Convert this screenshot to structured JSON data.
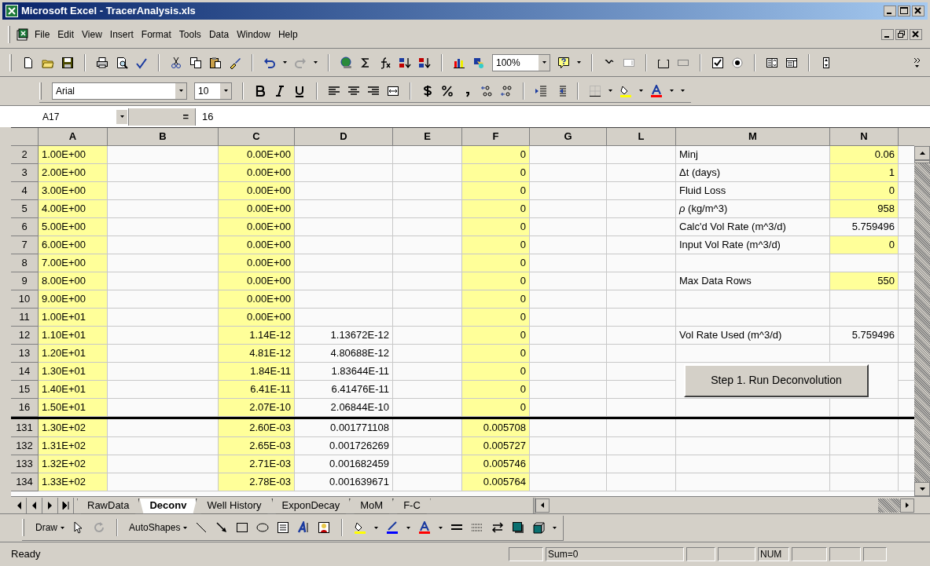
{
  "window": {
    "title": "Microsoft Excel - TracerAnalysis.xls"
  },
  "menu": [
    "File",
    "Edit",
    "View",
    "Insert",
    "Format",
    "Tools",
    "Data",
    "Window",
    "Help"
  ],
  "standard_toolbar": {
    "zoom": "100%"
  },
  "formatting_toolbar": {
    "font": "Arial",
    "size": "10"
  },
  "formula_bar": {
    "name_box": "A17",
    "equals": "=",
    "value": "16"
  },
  "sheet": {
    "columns": [
      {
        "label": "A"
      },
      {
        "label": "B"
      },
      {
        "label": "C"
      },
      {
        "label": "D"
      },
      {
        "label": "E"
      },
      {
        "label": "F"
      },
      {
        "label": "G"
      },
      {
        "label": "L"
      },
      {
        "label": "M"
      },
      {
        "label": "N"
      }
    ],
    "rows_top": [
      {
        "header": "2",
        "cells": [
          "1.00E+00",
          null,
          "0.00E+00",
          null,
          null,
          "0",
          null,
          null,
          "Minj",
          "0.06"
        ],
        "highlighted": [
          true,
          false,
          true,
          false,
          false,
          true,
          false,
          false,
          false,
          true
        ]
      },
      {
        "header": "3",
        "cells": [
          "2.00E+00",
          null,
          "0.00E+00",
          null,
          null,
          "0",
          null,
          null,
          "Δt (days)",
          "1"
        ],
        "highlighted": [
          true,
          false,
          true,
          false,
          false,
          true,
          false,
          false,
          false,
          true
        ]
      },
      {
        "header": "4",
        "cells": [
          "3.00E+00",
          null,
          "0.00E+00",
          null,
          null,
          "0",
          null,
          null,
          "Fluid Loss",
          "0"
        ],
        "highlighted": [
          true,
          false,
          true,
          false,
          false,
          true,
          false,
          false,
          false,
          true
        ]
      },
      {
        "header": "5",
        "cells": [
          "4.00E+00",
          null,
          "0.00E+00",
          null,
          null,
          "0",
          null,
          null,
          "*ρ* (kg/m^3)",
          "958"
        ],
        "highlighted": [
          true,
          false,
          true,
          false,
          false,
          true,
          false,
          false,
          false,
          true
        ]
      },
      {
        "header": "6",
        "cells": [
          "5.00E+00",
          null,
          "0.00E+00",
          null,
          null,
          "0",
          null,
          null,
          "Calc'd Vol Rate (m^3/d)",
          "5.759496"
        ],
        "highlighted": [
          true,
          false,
          true,
          false,
          false,
          true,
          false,
          false,
          false,
          false
        ]
      },
      {
        "header": "7",
        "cells": [
          "6.00E+00",
          null,
          "0.00E+00",
          null,
          null,
          "0",
          null,
          null,
          "Input Vol Rate (m^3/d)",
          "0"
        ],
        "highlighted": [
          true,
          false,
          true,
          false,
          false,
          true,
          false,
          false,
          false,
          true
        ]
      },
      {
        "header": "8",
        "cells": [
          "7.00E+00",
          null,
          "0.00E+00",
          null,
          null,
          "0",
          null,
          null,
          null,
          null
        ],
        "highlighted": [
          true,
          false,
          true,
          false,
          false,
          true,
          false,
          false,
          false,
          false
        ]
      },
      {
        "header": "9",
        "cells": [
          "8.00E+00",
          null,
          "0.00E+00",
          null,
          null,
          "0",
          null,
          null,
          "Max Data Rows",
          "550"
        ],
        "highlighted": [
          true,
          false,
          true,
          false,
          false,
          true,
          false,
          false,
          false,
          true
        ]
      },
      {
        "header": "10",
        "cells": [
          "9.00E+00",
          null,
          "0.00E+00",
          null,
          null,
          "0",
          null,
          null,
          null,
          null
        ],
        "highlighted": [
          true,
          false,
          true,
          false,
          false,
          true,
          false,
          false,
          false,
          false
        ]
      },
      {
        "header": "11",
        "cells": [
          "1.00E+01",
          null,
          "0.00E+00",
          null,
          null,
          "0",
          null,
          null,
          null,
          null
        ],
        "highlighted": [
          true,
          false,
          true,
          false,
          false,
          true,
          false,
          false,
          false,
          false
        ]
      },
      {
        "header": "12",
        "cells": [
          "1.10E+01",
          null,
          "1.14E-12",
          "1.13672E-12",
          null,
          "0",
          null,
          null,
          "Vol Rate Used (m^3/d)",
          "5.759496"
        ],
        "highlighted": [
          true,
          false,
          true,
          false,
          false,
          true,
          false,
          false,
          false,
          false
        ]
      },
      {
        "header": "13",
        "cells": [
          "1.20E+01",
          null,
          "4.81E-12",
          "4.80688E-12",
          null,
          "0",
          null,
          null,
          null,
          null
        ],
        "highlighted": [
          true,
          false,
          true,
          false,
          false,
          true,
          false,
          false,
          false,
          false
        ]
      },
      {
        "header": "14",
        "cells": [
          "1.30E+01",
          null,
          "1.84E-11",
          "1.83644E-11",
          null,
          "0",
          null,
          null,
          null,
          null
        ],
        "highlighted": [
          true,
          false,
          true,
          false,
          false,
          true,
          false,
          false,
          false,
          false
        ]
      },
      {
        "header": "15",
        "cells": [
          "1.40E+01",
          null,
          "6.41E-11",
          "6.41476E-11",
          null,
          "0",
          null,
          null,
          null,
          null
        ],
        "highlighted": [
          true,
          false,
          true,
          false,
          false,
          true,
          false,
          false,
          false,
          false
        ]
      },
      {
        "header": "16",
        "cells": [
          "1.50E+01",
          null,
          "2.07E-10",
          "2.06844E-10",
          null,
          "0",
          null,
          null,
          null,
          null
        ],
        "highlighted": [
          true,
          false,
          true,
          false,
          false,
          true,
          false,
          false,
          false,
          false
        ]
      }
    ],
    "rows_bottom": [
      {
        "header": "131",
        "cells": [
          "1.30E+02",
          null,
          "2.60E-03",
          "0.001771108",
          null,
          "0.005708",
          null,
          null,
          null,
          null
        ],
        "highlighted": [
          true,
          false,
          true,
          false,
          false,
          true,
          false,
          false,
          false,
          false
        ]
      },
      {
        "header": "132",
        "cells": [
          "1.31E+02",
          null,
          "2.65E-03",
          "0.001726269",
          null,
          "0.005727",
          null,
          null,
          null,
          null
        ],
        "highlighted": [
          true,
          false,
          true,
          false,
          false,
          true,
          false,
          false,
          false,
          false
        ]
      },
      {
        "header": "133",
        "cells": [
          "1.32E+02",
          null,
          "2.71E-03",
          "0.001682459",
          null,
          "0.005746",
          null,
          null,
          null,
          null
        ],
        "highlighted": [
          true,
          false,
          true,
          false,
          false,
          true,
          false,
          false,
          false,
          false
        ]
      },
      {
        "header": "134",
        "cells": [
          "1.33E+02",
          null,
          "2.78E-03",
          "0.001639671",
          null,
          "0.005764",
          null,
          null,
          null,
          null
        ],
        "highlighted": [
          true,
          false,
          true,
          false,
          false,
          true,
          false,
          false,
          false,
          false
        ]
      }
    ]
  },
  "button": {
    "label": "Step 1. Run Deconvolution"
  },
  "sheet_tabs": [
    {
      "label": "RawData",
      "selected": false
    },
    {
      "label": "Deconv",
      "selected": true
    },
    {
      "label": "Well History",
      "selected": false
    },
    {
      "label": "ExponDecay",
      "selected": false
    },
    {
      "label": "MoM",
      "selected": false
    },
    {
      "label": "F-C",
      "selected": false
    }
  ],
  "drawing_toolbar": {
    "draw": "Draw",
    "autoshapes": "AutoShapes"
  },
  "status_bar": {
    "mode": "Ready",
    "sum": "Sum=0",
    "num": "NUM"
  }
}
